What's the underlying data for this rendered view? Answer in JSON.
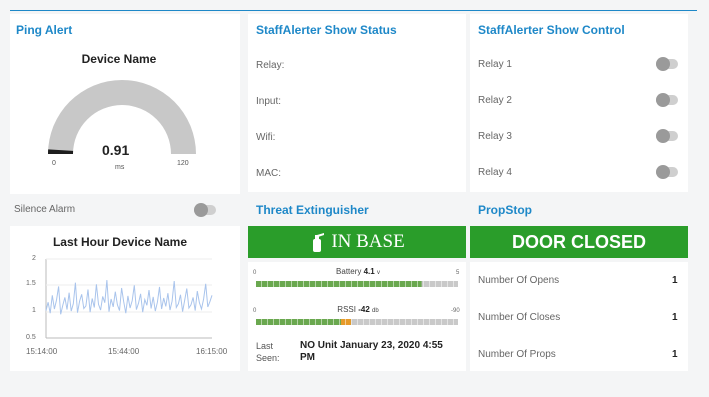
{
  "ping": {
    "title": "Ping Alert",
    "gauge": {
      "label": "Device Name",
      "value": "0.91",
      "unit": "ms",
      "min": "0",
      "max": "120",
      "fraction": 0.0076
    },
    "silence_label": "Silence Alarm",
    "chart_title": "Last Hour Device Name"
  },
  "status": {
    "title": "StaffAlerter Show Status",
    "rows": [
      "Relay:",
      "Input:",
      "Wifi:",
      "MAC:"
    ]
  },
  "control": {
    "title": "StaffAlerter Show Control",
    "relays": [
      "Relay 1",
      "Relay 2",
      "Relay 3",
      "Relay 4"
    ]
  },
  "threat": {
    "title": "Threat Extinguisher",
    "banner": "IN BASE",
    "battery": {
      "label": "Battery",
      "value": "4.1",
      "unit": "v",
      "min": "0",
      "max": "5",
      "fraction": 0.82
    },
    "rssi": {
      "label": "RSSI",
      "value": "-42",
      "unit": "db",
      "min": "0",
      "max": "-90",
      "fraction": 0.47
    },
    "last_seen_label": "Last Seen:",
    "last_seen_value": "NO Unit January 23, 2020 4:55 PM"
  },
  "propstop": {
    "title": "PropStop",
    "banner": "DOOR CLOSED",
    "rows": [
      {
        "label": "Number Of Opens",
        "value": "1"
      },
      {
        "label": "Number Of Closes",
        "value": "1"
      },
      {
        "label": "Number Of Props",
        "value": "1"
      }
    ]
  },
  "colors": {
    "accent": "#1e88c8",
    "ok": "#2a9d2a",
    "series": "#a9c4ec"
  },
  "chart_data": {
    "type": "line",
    "title": "Last Hour Device Name",
    "x": [
      "15:14:00",
      "15:44:00",
      "16:15:00"
    ],
    "ylim": [
      0.5,
      2
    ],
    "yticks": [
      "2",
      "1.5",
      "1",
      "0.5"
    ],
    "grid": true,
    "series": [
      {
        "values": [
          1.02,
          1.18,
          0.97,
          1.31,
          1.05,
          1.22,
          1.48,
          0.95,
          1.12,
          1.27,
          1.04,
          1.36,
          1.01,
          1.15,
          1.55,
          0.98,
          1.2,
          1.33,
          1.06,
          1.11,
          1.42,
          0.99,
          1.25,
          1.08,
          1.52,
          1.14,
          1.03,
          1.29,
          1.17,
          1.6,
          1.0,
          1.24,
          1.09,
          1.38,
          1.13,
          1.02,
          1.45,
          1.19,
          0.97,
          1.3,
          1.07,
          1.21,
          1.5,
          1.04,
          1.16,
          1.34,
          0.99,
          1.23,
          1.12,
          1.41,
          1.06,
          1.28,
          1.01,
          1.18,
          1.47,
          1.05,
          1.26,
          1.1,
          1.35,
          1.03,
          1.2,
          1.58,
          1.08,
          1.15,
          1.32,
          1.0,
          1.22,
          1.44,
          1.07,
          1.13,
          1.27,
          1.02,
          1.39,
          1.17,
          1.05,
          1.24,
          1.53,
          1.09,
          1.19,
          1.31
        ]
      }
    ]
  }
}
